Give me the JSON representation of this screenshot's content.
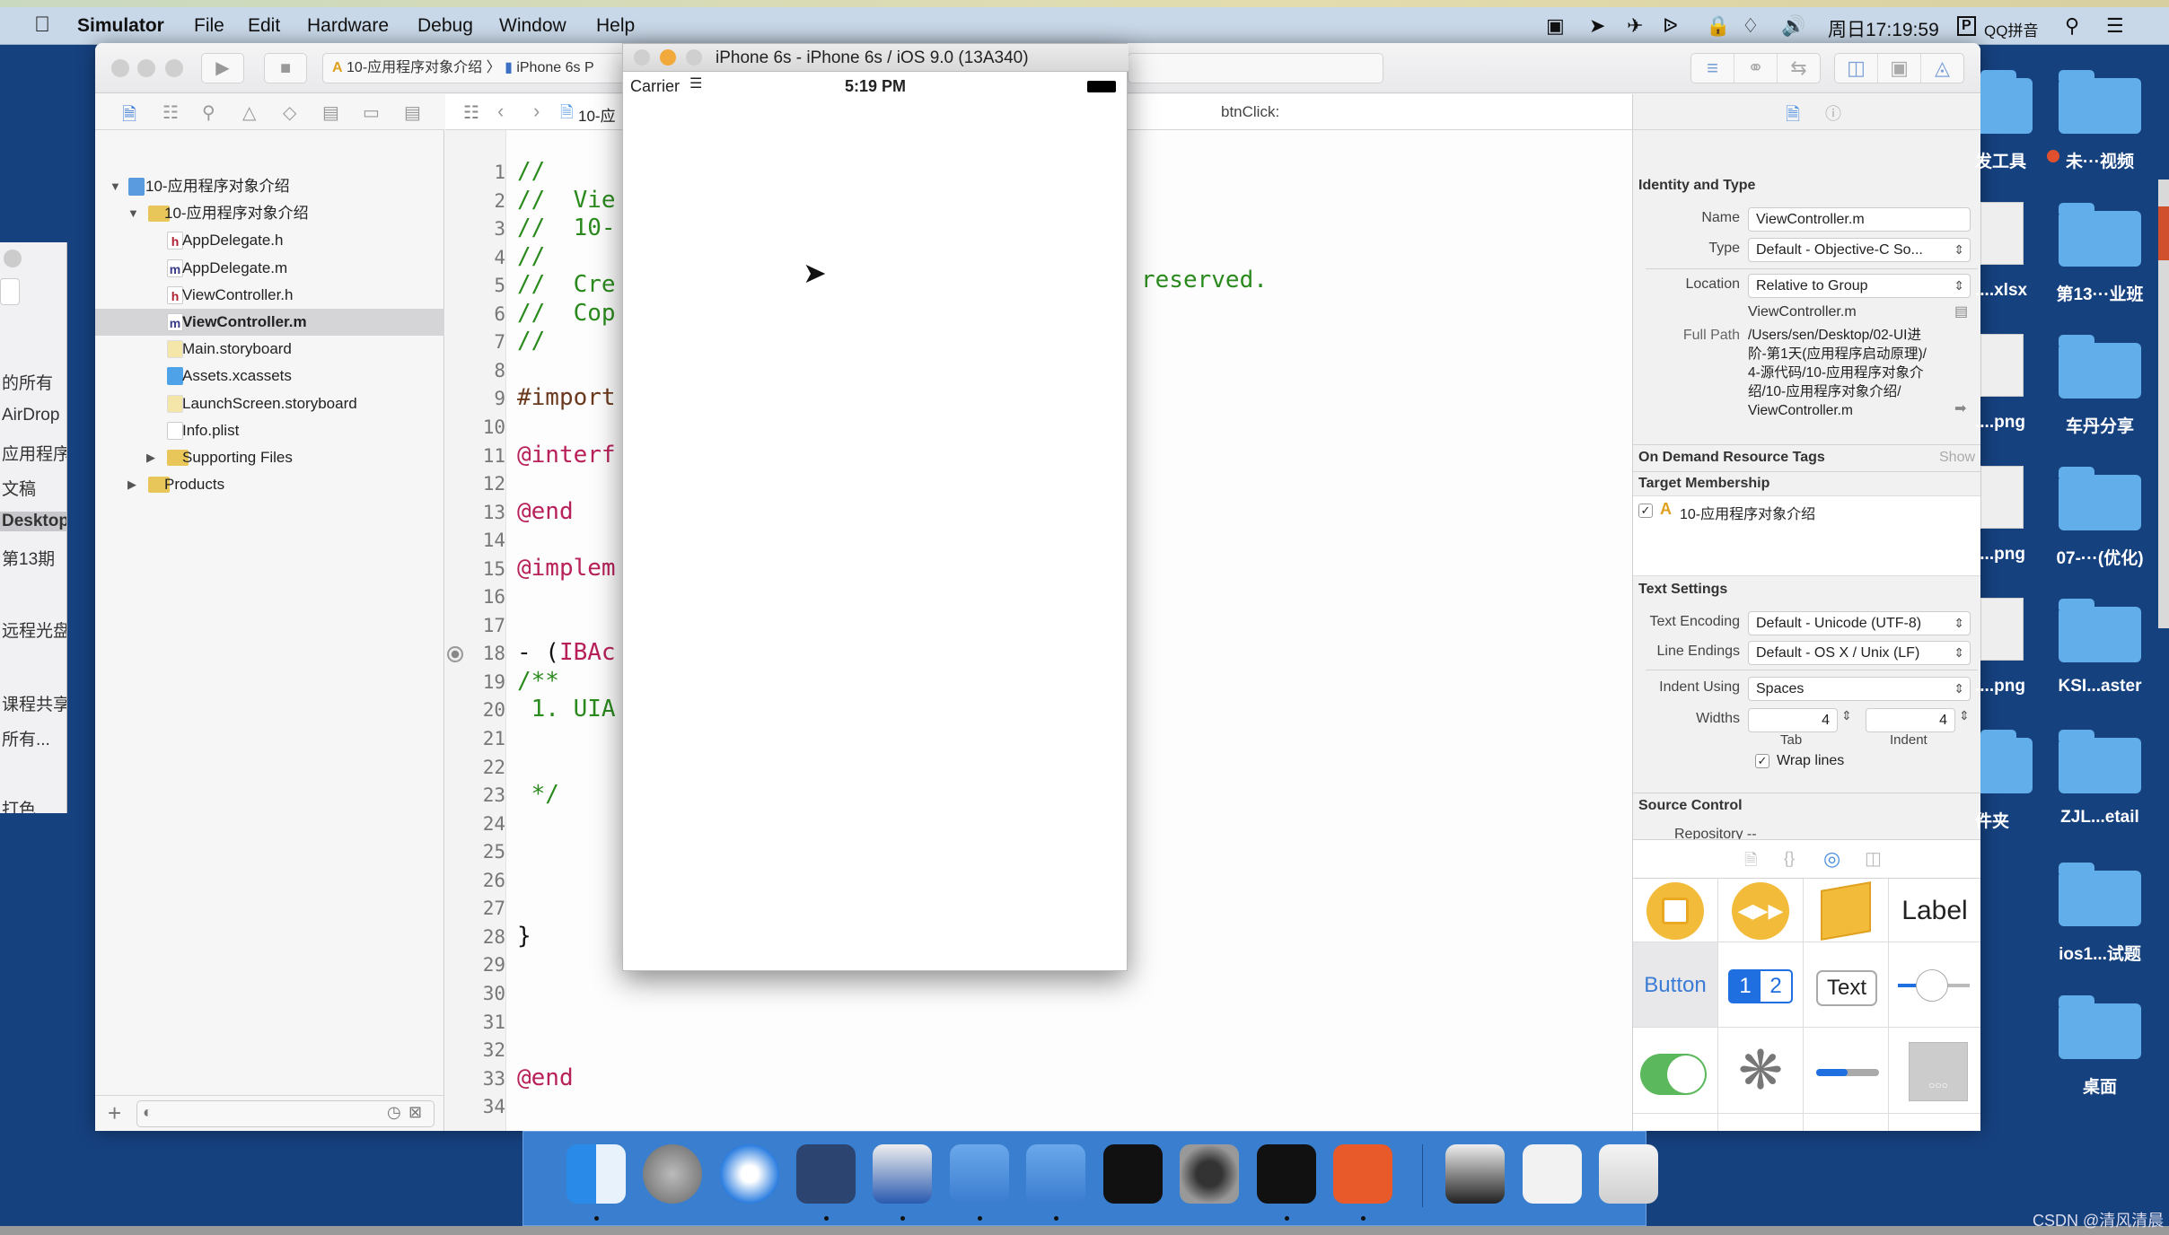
{
  "menubar": {
    "app": "Simulator",
    "items": [
      "File",
      "Edit",
      "Hardware",
      "Debug",
      "Window",
      "Help"
    ],
    "clock": "周日17:19:59",
    "input_method": "QQ拼音"
  },
  "finder_sidebar": [
    "的所有",
    "AirDrop",
    "应用程序",
    "文稿",
    "Desktop",
    "第13期",
    "远程光盘",
    "课程共享",
    "所有...",
    "打色"
  ],
  "desktop": {
    "col1": [
      "发工具",
      "....xlsx",
      "....png",
      "....png",
      "....png",
      "件夹"
    ],
    "col2": [
      "未···视频",
      "第13···业班",
      "车丹分享",
      "07-···(优化)",
      "KSI...aster",
      "ZJL...etail",
      "ios1...试题",
      "桌面"
    ]
  },
  "xcode": {
    "scheme": "10-应用程序对象介绍",
    "device": "iPhone 6s P",
    "navigator": [
      {
        "label": "10-应用程序对象介绍",
        "icon": "project",
        "level": 0,
        "disclosure": "open"
      },
      {
        "label": "10-应用程序对象介绍",
        "icon": "folder",
        "level": 1,
        "disclosure": "open"
      },
      {
        "label": "AppDelegate.h",
        "icon": "h",
        "level": 2
      },
      {
        "label": "AppDelegate.m",
        "icon": "m",
        "level": 2
      },
      {
        "label": "ViewController.h",
        "icon": "h",
        "level": 2
      },
      {
        "label": "ViewController.m",
        "icon": "m",
        "level": 2,
        "selected": true
      },
      {
        "label": "Main.storyboard",
        "icon": "storyboard",
        "level": 2
      },
      {
        "label": "Assets.xcassets",
        "icon": "assets",
        "level": 2
      },
      {
        "label": "LaunchScreen.storyboard",
        "icon": "storyboard",
        "level": 2
      },
      {
        "label": "Info.plist",
        "icon": "plist",
        "level": 2
      },
      {
        "label": "Supporting Files",
        "icon": "folder",
        "level": 2,
        "disclosure": "closed"
      },
      {
        "label": "Products",
        "icon": "folder",
        "level": 1,
        "disclosure": "closed"
      }
    ],
    "jumpbar": {
      "crumb": "10-应",
      "method": "btnClick:"
    },
    "code": [
      [
        [
          "//",
          "comment"
        ]
      ],
      [
        [
          "//  Vie",
          "comment"
        ]
      ],
      [
        [
          "//  10-",
          "comment"
        ]
      ],
      [
        [
          "//",
          "comment"
        ]
      ],
      [
        [
          "//  Cre",
          "comment"
        ]
      ],
      [
        [
          "//  Cop",
          "comment"
        ]
      ],
      [
        [
          "//",
          "comment"
        ]
      ],
      [],
      [
        [
          "#import",
          "pre"
        ]
      ],
      [],
      [
        [
          "@interf",
          "kw"
        ]
      ],
      [],
      [
        [
          "@end",
          "kw"
        ]
      ],
      [],
      [
        [
          "@implem",
          "kw"
        ]
      ],
      [],
      [],
      [
        [
          "- (",
          "plain"
        ],
        [
          "IBAc",
          "kw"
        ]
      ],
      [
        [
          "/**",
          "comment"
        ]
      ],
      [
        [
          " 1. UIA",
          "comment"
        ]
      ],
      [],
      [],
      [
        [
          " */",
          "comment"
        ]
      ],
      [],
      [],
      [],
      [],
      [
        [
          "}",
          "plain"
        ]
      ],
      [],
      [],
      [],
      [],
      [
        [
          "@end",
          "kw"
        ]
      ],
      []
    ],
    "code_overflow_text": "reserved.",
    "breakpoint_line": 18
  },
  "inspector": {
    "identity": {
      "title": "Identity and Type",
      "name_label": "Name",
      "name": "ViewController.m",
      "type_label": "Type",
      "type": "Default - Objective-C So...",
      "location_label": "Location",
      "location": "Relative to Group",
      "file": "ViewController.m",
      "fullpath_label": "Full Path",
      "fullpath": [
        "/Users/sen/Desktop/02-UI进",
        "阶-第1天(应用程序启动原理)/",
        "4-源代码/10-应用程序对象介",
        "绍/10-应用程序对象介绍/",
        "ViewController.m"
      ]
    },
    "odr": {
      "title": "On Demand Resource Tags",
      "show": "Show"
    },
    "target": {
      "title": "Target Membership",
      "item": "10-应用程序对象介绍",
      "checked": true
    },
    "text": {
      "title": "Text Settings",
      "enc_label": "Text Encoding",
      "enc": "Default - Unicode (UTF-8)",
      "le_label": "Line Endings",
      "le": "Default - OS X / Unix (LF)",
      "indent_label": "Indent Using",
      "indent": "Spaces",
      "widths_label": "Widths",
      "tab": "4",
      "indent_w": "4",
      "tab_label": "Tab",
      "indent_w_label": "Indent",
      "wrap": "Wrap lines",
      "wrap_checked": true
    },
    "source": {
      "title": "Source Control",
      "repo": "Repository  --"
    },
    "library": {
      "label": "Label",
      "button": "Button",
      "seg1": "1",
      "seg2": "2",
      "text": "Text"
    }
  },
  "simulator": {
    "title": "iPhone 6s - iPhone 6s / iOS 9.0 (13A340)",
    "carrier": "Carrier",
    "time": "5:19 PM"
  },
  "dock": [
    "finder",
    "launchpad",
    "safari",
    "mouse",
    "photo-slideshow",
    "xcode",
    "simulator",
    "terminal",
    "system-preferences",
    "exec-terminal",
    "powerpoint",
    "screen-sharing",
    "preview-document",
    "trash"
  ],
  "watermark": "CSDN @清风清晨"
}
